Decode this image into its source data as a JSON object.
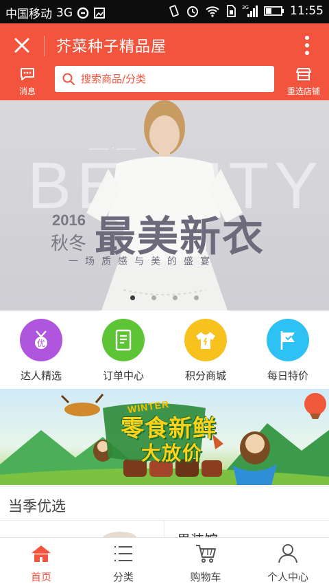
{
  "status_bar": {
    "carrier": "中国移动",
    "network": "3G",
    "signal_type": "3G",
    "time": "11:55"
  },
  "header": {
    "title": "芥菜种子精品屋",
    "message_label": "消息",
    "search_placeholder": "搜索商品/分类",
    "reselect_label": "重选店铺"
  },
  "banner": {
    "bg_word": "BEAUTY",
    "year": "2016",
    "season": "秋冬",
    "headline": "最美新衣",
    "subtitle": "一场质感与美的盛宴",
    "slide_count": 4,
    "active_slide": 1
  },
  "quick_menu": [
    {
      "label": "达人精选",
      "color": "#b055de",
      "icon": "medal-icon"
    },
    {
      "label": "订单中心",
      "color": "#5cc435",
      "icon": "order-icon"
    },
    {
      "label": "积分商城",
      "color": "#f7c21e",
      "icon": "tshirt-icon"
    },
    {
      "label": "每日特价",
      "color": "#2ec1f4",
      "icon": "flag-icon"
    }
  ],
  "promo": {
    "tag": "WINTER",
    "title": "零食新鲜",
    "subtitle": "大放价"
  },
  "section": {
    "title": "当季优选",
    "peek_title": "男装馆"
  },
  "bottom_nav": [
    {
      "label": "首页",
      "icon": "home-icon",
      "active": true
    },
    {
      "label": "分类",
      "icon": "category-icon",
      "active": false
    },
    {
      "label": "购物车",
      "icon": "cart-icon",
      "active": false
    },
    {
      "label": "个人中心",
      "icon": "user-icon",
      "active": false
    }
  ],
  "colors": {
    "accent": "#f2543d"
  }
}
